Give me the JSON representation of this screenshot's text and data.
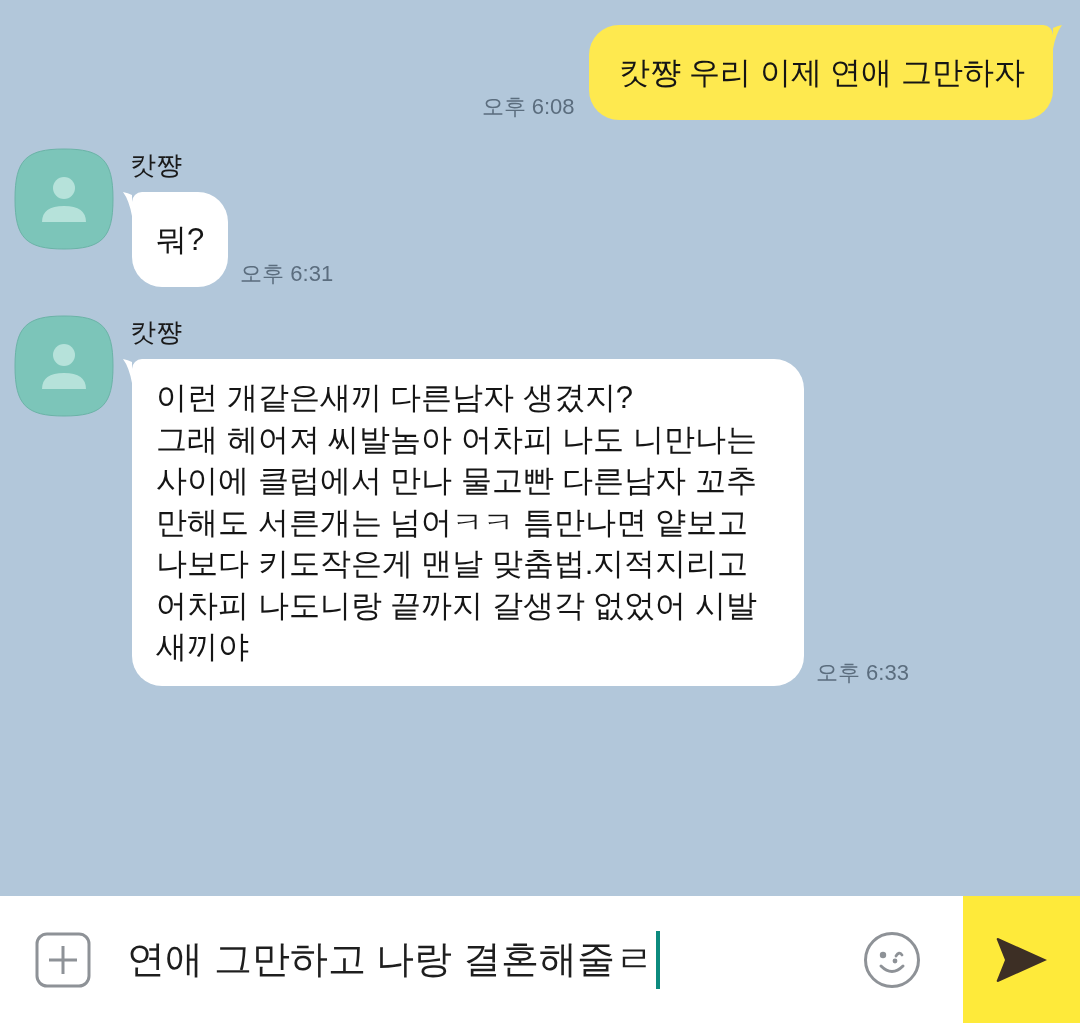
{
  "messages": [
    {
      "kind": "sent",
      "text": "캇쨩 우리 이제 연애 그만하자",
      "time": "오후 6:08"
    },
    {
      "kind": "received",
      "sender": "캇쨩",
      "text": "뭐?",
      "time": "오후 6:31"
    },
    {
      "kind": "received",
      "sender": "캇쨩",
      "text": "이런 개같은새끼 다른남자 생겼지?\n그래 헤어져 씨발놈아 어차피 나도 니만나는 사이에 클럽에서 만나 물고빤 다른남자 꼬추 만해도 서른개는 넘어ㅋㅋ 틈만나면 얕보고 나보다 키도작은게 맨날 맞춤법.지적지리고 어차피 나도니랑 끝까지 갈생각 없었어 시발 새끼야",
      "time": "오후 6:33"
    }
  ],
  "composer": {
    "value": "연애 그만하고 나랑 결혼해줄ㄹ"
  }
}
